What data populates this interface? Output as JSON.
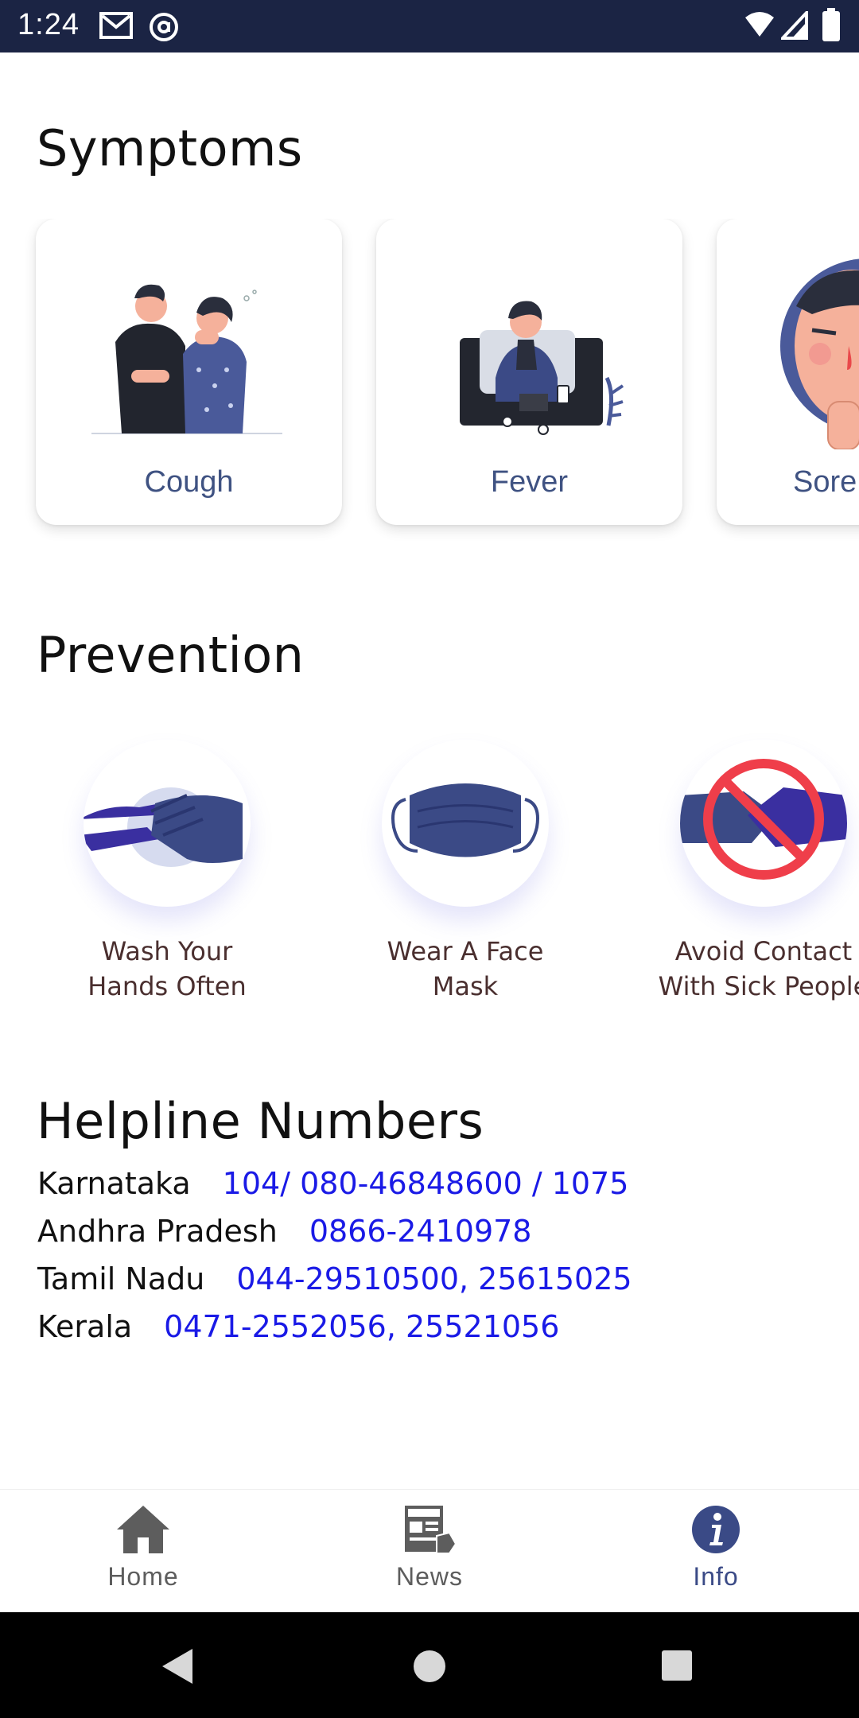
{
  "status_bar": {
    "time": "1:24",
    "left_icons": [
      "gmail-icon",
      "at-sign-icon"
    ],
    "right_icons": [
      "wifi-icon",
      "signal-icon",
      "battery-icon"
    ]
  },
  "symptoms": {
    "title": "Symptoms",
    "cards": [
      {
        "label": "Cough",
        "icon": "cough-illustration"
      },
      {
        "label": "Fever",
        "icon": "fever-illustration"
      },
      {
        "label": "Sore",
        "icon": "sore-throat-illustration"
      }
    ]
  },
  "prevention": {
    "title": "Prevention",
    "items": [
      {
        "line1": "Wash Your",
        "line2": "Hands Often",
        "icon": "hand-wash-icon"
      },
      {
        "line1": "Wear A Face",
        "line2": "Mask",
        "icon": "face-mask-icon"
      },
      {
        "line1": "Avoid Contact",
        "line2": "With Sick People",
        "icon": "no-handshake-icon"
      }
    ]
  },
  "helplines": {
    "title": "Helpline Numbers",
    "rows": [
      {
        "state": "Karnataka",
        "number": "104/ 080-46848600 / 1075"
      },
      {
        "state": "Andhra Pradesh",
        "number": "0866-2410978"
      },
      {
        "state": "Tamil Nadu",
        "number": "044-29510500, 25615025"
      },
      {
        "state": "Kerala",
        "number": "0471-2552056, 25521056"
      }
    ]
  },
  "bottom_nav": {
    "items": [
      {
        "label": "Home",
        "icon": "home-icon",
        "active": false
      },
      {
        "label": "News",
        "icon": "news-icon",
        "active": false
      },
      {
        "label": "Info",
        "icon": "info-icon",
        "active": true
      }
    ]
  },
  "colors": {
    "status_bar": "#1b2444",
    "link": "#1a1ae6",
    "card_label": "#3f5282",
    "active_nav": "#3a4a86"
  }
}
